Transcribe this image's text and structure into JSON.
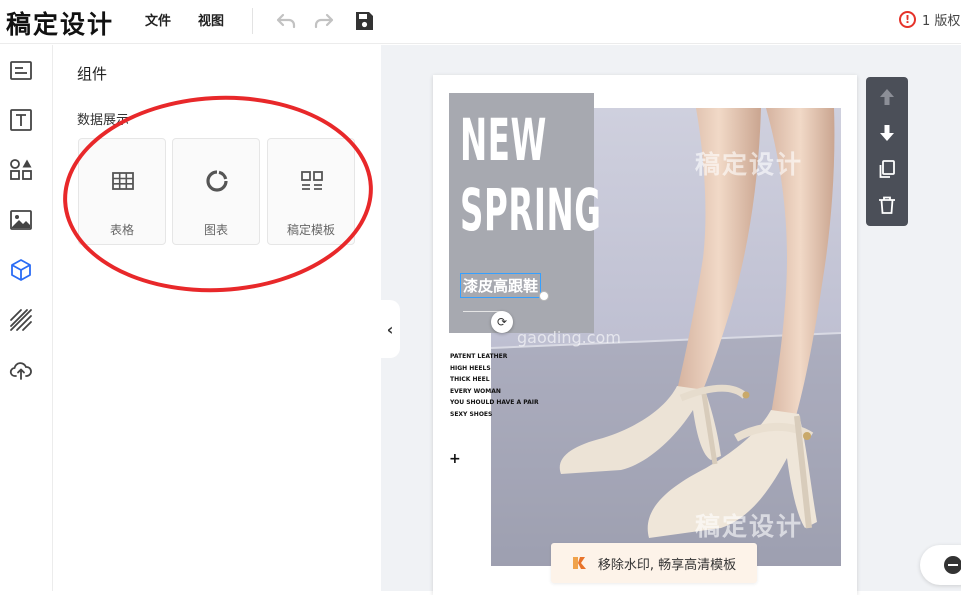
{
  "app": {
    "logo": "稿定设计"
  },
  "menu": {
    "file": "文件",
    "view": "视图"
  },
  "toolbar_icons": {
    "undo": "undo-icon",
    "redo": "redo-icon",
    "save": "save-icon"
  },
  "warning": {
    "icon": "!",
    "text": "1 版权"
  },
  "sidebar": {
    "items": [
      {
        "name": "template-icon"
      },
      {
        "name": "text-icon"
      },
      {
        "name": "elements-icon"
      },
      {
        "name": "image-icon"
      },
      {
        "name": "component-icon",
        "active": true
      },
      {
        "name": "background-icon"
      },
      {
        "name": "upload-icon"
      }
    ]
  },
  "panel": {
    "title": "组件",
    "section": "数据展示",
    "cards": [
      {
        "label": "表格",
        "icon": "table-icon"
      },
      {
        "label": "图表",
        "icon": "chart-icon"
      },
      {
        "label": "稿定模板",
        "icon": "template-grid-icon"
      }
    ]
  },
  "design": {
    "headline_line1": "NEW",
    "headline_line2": "SPRING",
    "subtitle": "漆皮高跟鞋",
    "body_lines": [
      "PATENT LEATHER",
      "HIGH HEELS",
      "THICK HEEL",
      "EVERY WOMAN",
      "YOU SHOULD HAVE A PAIR",
      "SEXY SHOES"
    ],
    "plus": "+",
    "watermark": "稿定设计",
    "watermark_url": "gaoding.com"
  },
  "promo": {
    "text": "移除水印, 畅享高清模板"
  },
  "colors": {
    "accent": "#2a6cf5",
    "warning": "#e5332a",
    "annotation": "#e8282a",
    "toolbar": "#4b4f58"
  }
}
